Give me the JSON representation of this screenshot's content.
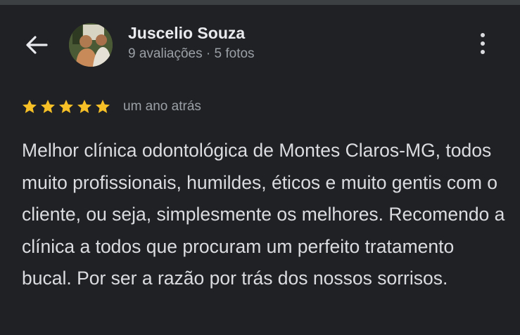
{
  "header": {
    "back_icon": "arrow-left-icon",
    "reviewer_name": "Juscelio Souza",
    "reviewer_meta": "9 avaliações · 5 fotos",
    "more_icon": "more-vert-icon"
  },
  "review": {
    "rating": 5,
    "rating_max": 5,
    "time_ago": "um ano atrás",
    "text": "Melhor clínica odontológica de Montes Claros-MG, todos muito profissionais, humildes, éticos e muito gentis com o cliente, ou seja, simplesmente os melhores. Recomendo a clínica a todos que procuram um perfeito tratamento bucal. Por ser a razão por trás dos nossos sorrisos."
  },
  "colors": {
    "background": "#202124",
    "star": "#f6c026",
    "secondary_text": "#9aa0a6"
  }
}
